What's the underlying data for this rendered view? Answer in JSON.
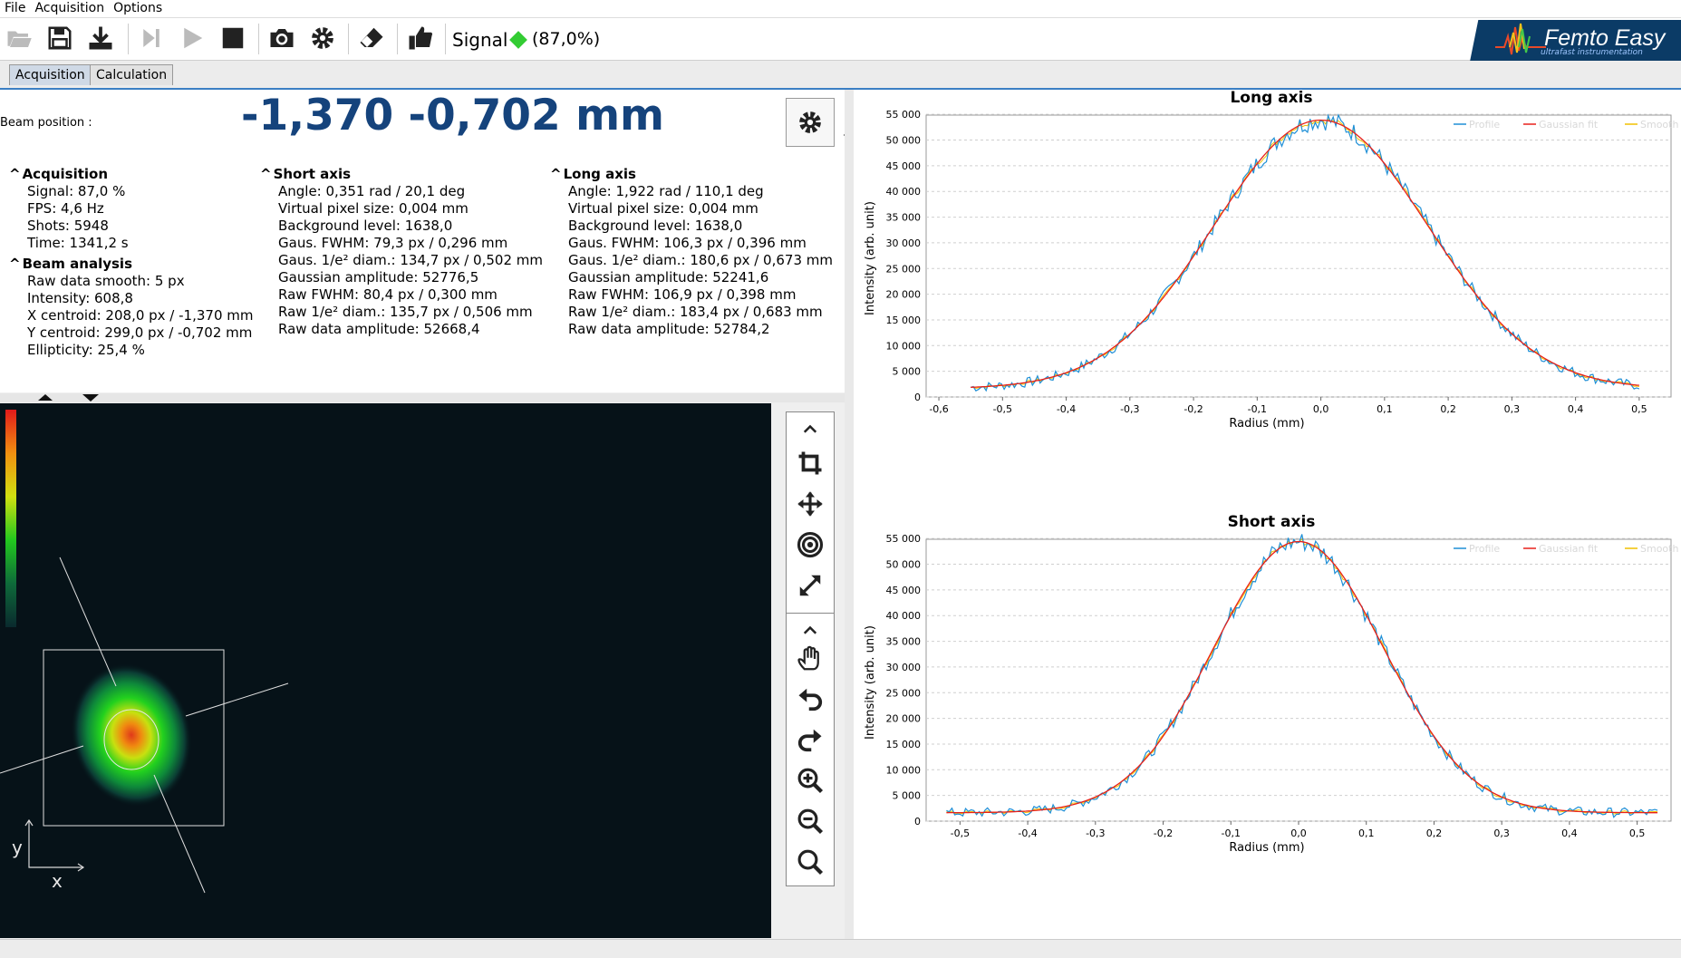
{
  "menu": [
    "File",
    "Acquisition",
    "Options"
  ],
  "toolbar": {
    "signal_label": "Signal",
    "signal_value": "(87,0%)",
    "signal_color": "#33cc33",
    "icons": [
      "folder-open-icon",
      "save-icon",
      "download-icon",
      "step-forward-icon",
      "play-icon",
      "stop-icon",
      "camera-icon",
      "gear-icon",
      "eraser-icon",
      "thumbs-up-icon"
    ]
  },
  "logo": {
    "title": "Femto Easy",
    "subtitle": "ultrafast instrumentation"
  },
  "tabs": [
    "Acquisition",
    "Calculation"
  ],
  "beam_position": {
    "label": "Beam position :",
    "value": "-1,370 -0,702 mm"
  },
  "acquisition": {
    "title": "Acquisition",
    "rows": [
      "Signal: 87,0 %",
      "FPS: 4,6 Hz",
      "Shots: 5948",
      "Time: 1341,2 s"
    ]
  },
  "beam_analysis": {
    "title": "Beam analysis",
    "rows": [
      "Raw data smooth: 5 px",
      "Intensity: 608,8",
      "X centroid: 208,0 px / -1,370 mm",
      "Y centroid: 299,0 px / -0,702 mm",
      "Ellipticity: 25,4 %"
    ]
  },
  "short_axis": {
    "title": "Short axis",
    "rows": [
      "Angle: 0,351 rad / 20,1 deg",
      "Virtual pixel size: 0,004 mm",
      "Background level: 1638,0",
      "Gaus. FWHM: 79,3 px / 0,296 mm",
      "Gaus. 1/e² diam.: 134,7 px / 0,502 mm",
      "Gaussian amplitude: 52776,5",
      "Raw FWHM: 80,4 px / 0,300 mm",
      "Raw 1/e² diam.: 135,7 px / 0,506 mm",
      "Raw data amplitude: 52668,4"
    ]
  },
  "long_axis": {
    "title": "Long axis",
    "rows": [
      "Angle: 1,922 rad / 110,1 deg",
      "Virtual pixel size: 0,004 mm",
      "Background level: 1638,0",
      "Gaus. FWHM: 106,3 px / 0,396 mm",
      "Gaus. 1/e² diam.: 180,6 px / 0,673 mm",
      "Gaussian amplitude: 52241,6",
      "Raw FWHM: 106,9 px / 0,398 mm",
      "Raw 1/e² diam.: 183,4 px / 0,683 mm",
      "Raw data amplitude: 52784,2"
    ]
  },
  "axes_labels": {
    "x": "x",
    "y": "y"
  },
  "tool_icons": [
    "collapse-up-icon",
    "crop-icon",
    "move-icon",
    "target-icon",
    "expand-icon",
    "collapse-up-icon",
    "hand-icon",
    "undo-icon",
    "redo-icon",
    "zoom-in-icon",
    "zoom-out-icon",
    "zoom-reset-icon"
  ],
  "chart_data": [
    {
      "type": "line",
      "title": "Long axis",
      "xlabel": "Radius (mm)",
      "ylabel": "Intensity (arb. unit)",
      "xlim": [
        -0.62,
        0.55
      ],
      "ylim": [
        0,
        57500
      ],
      "xticks": [
        "-0,6",
        "-0,5",
        "-0,4",
        "-0,3",
        "-0,2",
        "-0,1",
        "0,0",
        "0,1",
        "0,2",
        "0,3",
        "0,4",
        "0,5"
      ],
      "yticks": [
        "0",
        "5 000",
        "10 000",
        "15 000",
        "20 000",
        "25 000",
        "30 000",
        "35 000",
        "40 000",
        "45 000",
        "50 000",
        "55 000"
      ],
      "legend": [
        "Profile",
        "Gaussian fit",
        "Smooth"
      ],
      "legend_position": "top-right",
      "grid": true,
      "colors": {
        "Profile": "#1f8fd6",
        "Gaussian fit": "#e8201a",
        "Smooth": "#f0c000"
      },
      "gaussian": {
        "amplitude": 52241.6,
        "center": 0.0,
        "fwhm": 0.396,
        "background": 1638.0
      },
      "x_range": [
        -0.55,
        0.5
      ]
    },
    {
      "type": "line",
      "title": "Short axis",
      "xlabel": "Radius (mm)",
      "ylabel": "Intensity (arb. unit)",
      "xlim": [
        -0.55,
        0.55
      ],
      "ylim": [
        0,
        57500
      ],
      "xticks": [
        "-0,5",
        "-0,4",
        "-0,3",
        "-0,2",
        "-0,1",
        "0,0",
        "0,1",
        "0,2",
        "0,3",
        "0,4",
        "0,5"
      ],
      "yticks": [
        "0",
        "5 000",
        "10 000",
        "15 000",
        "20 000",
        "25 000",
        "30 000",
        "35 000",
        "40 000",
        "45 000",
        "50 000",
        "55 000"
      ],
      "legend": [
        "Profile",
        "Gaussian fit",
        "Smooth"
      ],
      "legend_position": "top-right",
      "grid": true,
      "colors": {
        "Profile": "#1f8fd6",
        "Gaussian fit": "#e8201a",
        "Smooth": "#f0c000"
      },
      "gaussian": {
        "amplitude": 52776.5,
        "center": 0.0,
        "fwhm": 0.296,
        "background": 1638.0
      },
      "x_range": [
        -0.52,
        0.53
      ]
    }
  ]
}
